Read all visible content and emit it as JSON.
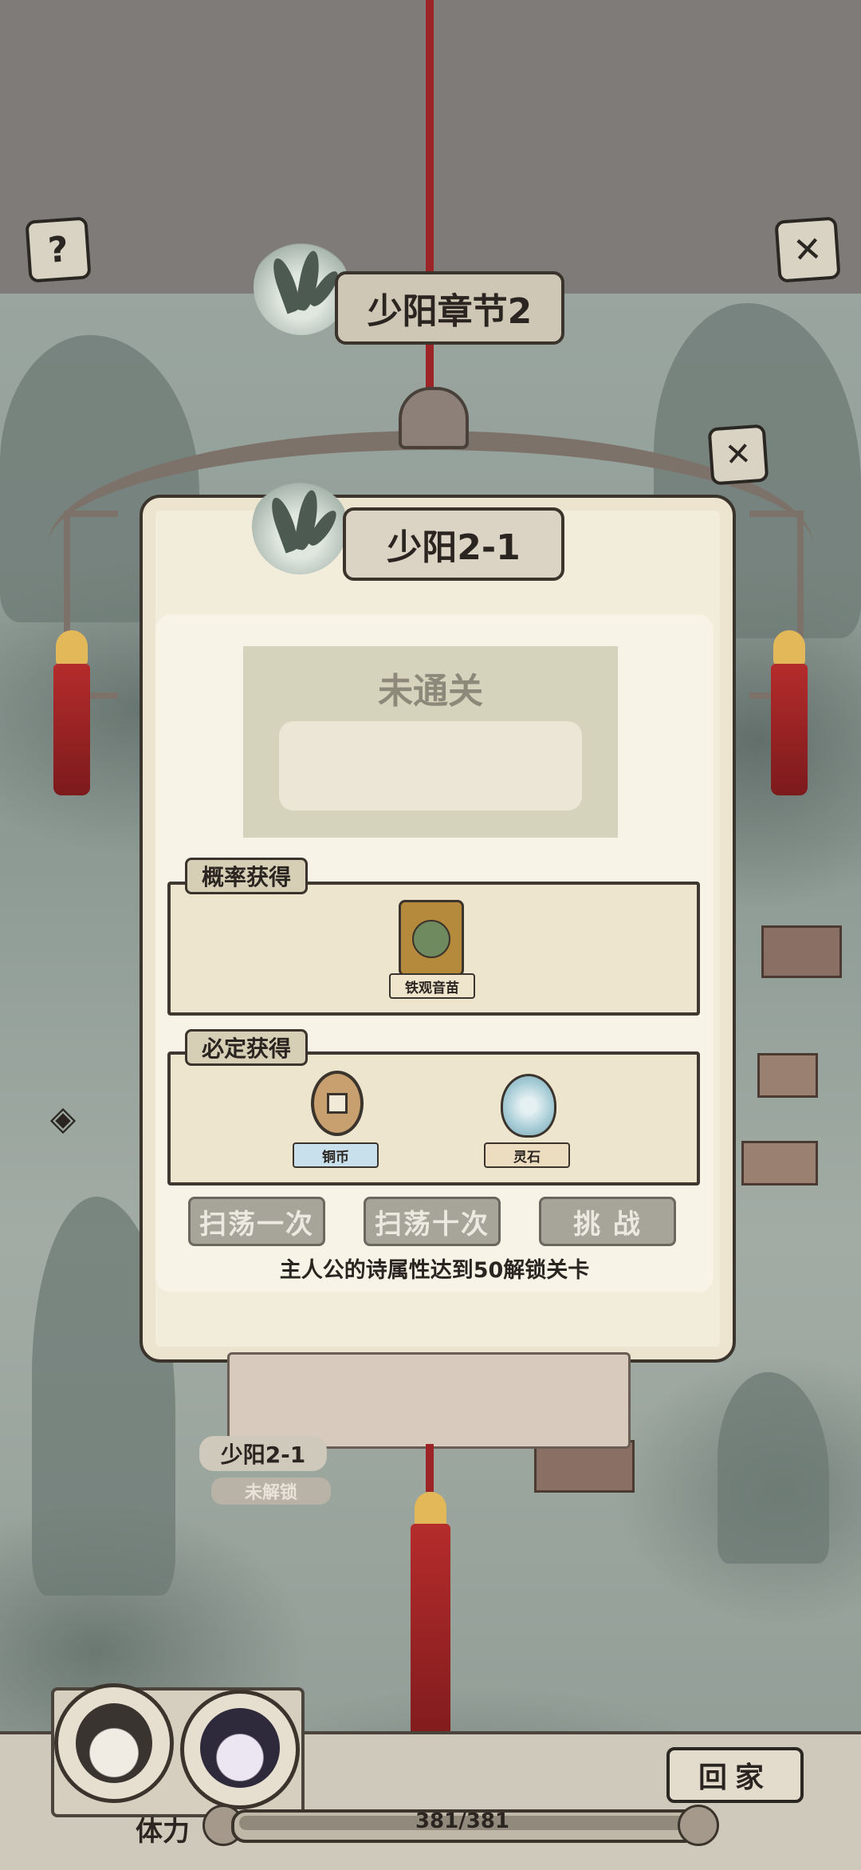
{
  "header": {
    "help_icon": "question-icon",
    "close_icon": "x-icon",
    "chapter_title": "少阳章节2"
  },
  "dialog": {
    "stage_title": "少阳2-1",
    "close_icon": "x-icon",
    "status_text": "未通关",
    "chance_rewards": {
      "label": "概率获得",
      "items": [
        {
          "name": "铁观音苗",
          "icon": "tea-seedling-icon"
        }
      ]
    },
    "guaranteed_rewards": {
      "label": "必定获得",
      "items": [
        {
          "name": "铜币",
          "icon": "copper-coin-icon",
          "tag_color": "#c8e0ec"
        },
        {
          "name": "灵石",
          "icon": "spirit-stone-icon",
          "tag_color": "#ecdcc0"
        }
      ]
    },
    "buttons": {
      "sweep_once": "扫荡一次",
      "sweep_ten": "扫荡十次",
      "challenge": "挑 战"
    },
    "unlock_hint": "主人公的诗属性达到50解锁关卡"
  },
  "map": {
    "stage_label": "少阳2-1",
    "stage_status": "未解锁",
    "nav_arrow_icon": "left-arrow-icon"
  },
  "footer": {
    "home_button": "回家",
    "stamina_label": "体力",
    "stamina_value": "381/381",
    "stamina_fill": 1.0
  },
  "colors": {
    "rope": "#9c2426",
    "panel": "#f2ecdb",
    "tassel": "#b52c2c",
    "tassel_cap": "#e3b858"
  }
}
